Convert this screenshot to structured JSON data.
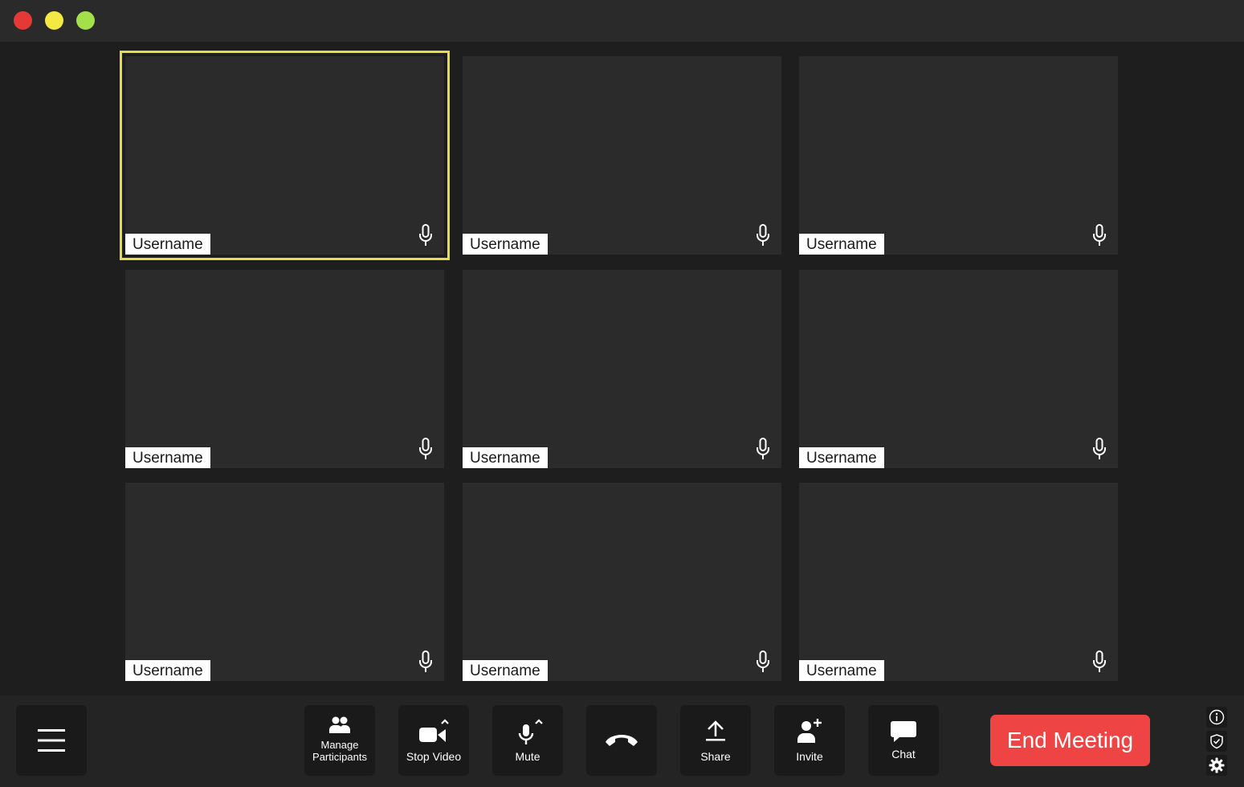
{
  "window": {
    "controls": [
      "close-dot",
      "minimize-dot",
      "maximize-dot"
    ],
    "colors": {
      "close": "#e53935",
      "minimize": "#f4e842",
      "maximize": "#a3e04a"
    }
  },
  "participants": [
    {
      "name": "Username",
      "active": true
    },
    {
      "name": "Username",
      "active": false
    },
    {
      "name": "Username",
      "active": false
    },
    {
      "name": "Username",
      "active": false
    },
    {
      "name": "Username",
      "active": false
    },
    {
      "name": "Username",
      "active": false
    },
    {
      "name": "Username",
      "active": false
    },
    {
      "name": "Username",
      "active": false
    },
    {
      "name": "Username",
      "active": false
    }
  ],
  "toolbar": {
    "menu_icon": "hamburger-icon",
    "manage_participants_line1": "Manage",
    "manage_participants_line2": "Participants",
    "stop_video_label": "Stop Video",
    "mute_label": "Mute",
    "hangup_icon": "phone-hangup-icon",
    "share_label": "Share",
    "invite_label": "Invite",
    "chat_label": "Chat",
    "end_meeting_label": "End Meeting",
    "side_icons": [
      "info-icon",
      "shield-icon",
      "gear-icon"
    ]
  },
  "colors": {
    "active_border": "#e6dc4a",
    "end_meeting": "#ef4444",
    "tile_bg": "#2b2b2b"
  }
}
